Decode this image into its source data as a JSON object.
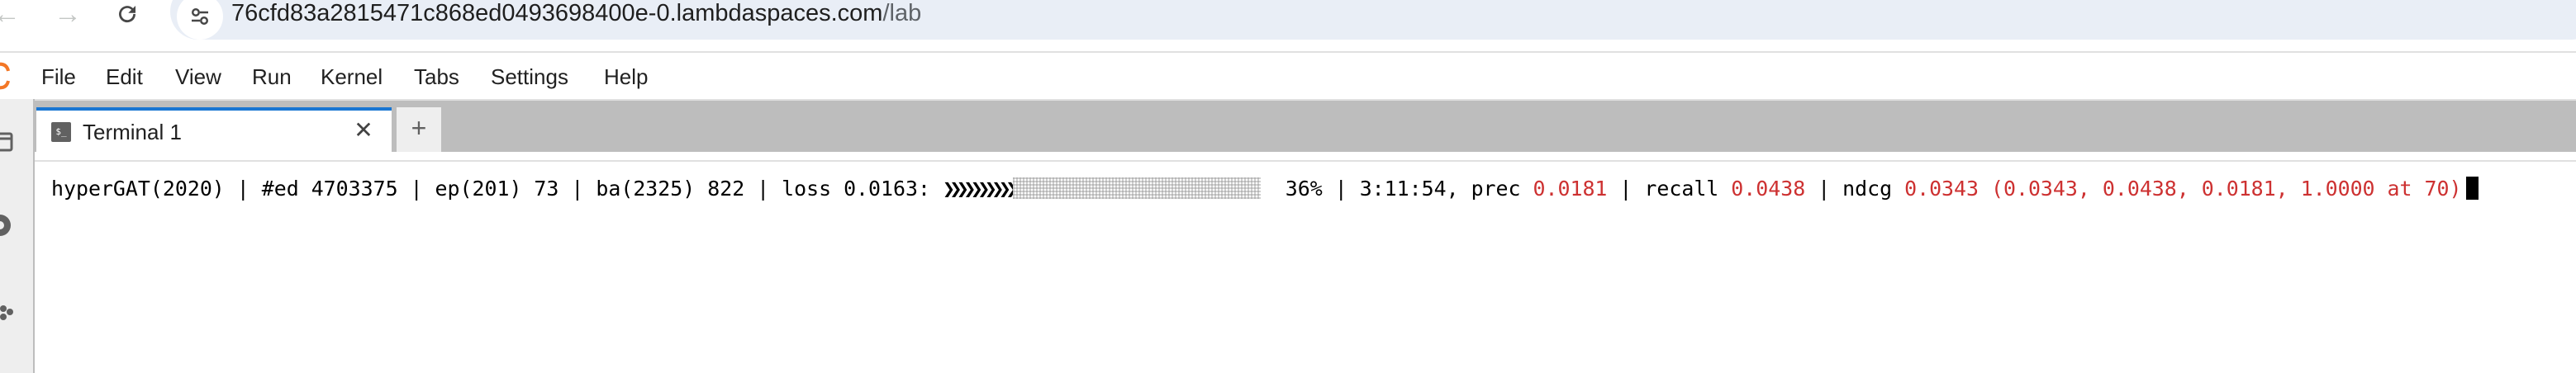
{
  "browser": {
    "url_host": "76cfd83a2815471c868ed0493698400e-0.lambdaspaces.com",
    "url_path": "/lab"
  },
  "menu": {
    "items": [
      "File",
      "Edit",
      "View",
      "Run",
      "Kernel",
      "Tabs",
      "Settings",
      "Help"
    ]
  },
  "tabs": [
    {
      "label": "Terminal 1",
      "icon": "terminal-icon",
      "active": true
    }
  ],
  "new_tab_label": "+",
  "close_glyph": "✕",
  "terminal": {
    "prefix": "hyperGAT(2020) | #ed 4703375 | ep(201) 73 | ba(2325) 822 | loss 0.0163: ",
    "progress_done": "❯❯❯❯❯❯❯❯❯❯",
    "progress_percent": "36%",
    "progress_fraction": 0.36,
    "after_bar": "  36% | 3:11:54, prec ",
    "prec_value": "0.0181",
    "sep_recall": " | recall ",
    "recall_value": "0.0438",
    "sep_ndcg": " | ndcg ",
    "ndcg_value": "0.0343 (0.0343, 0.0438, 0.0181, 1.0000 at 70)"
  },
  "colors": {
    "metric_value": "#cd3131",
    "active_tab_accent": "#1976d2",
    "tabstrip_bg": "#bdbdbd",
    "omnibox_bg": "#e9eef6"
  }
}
